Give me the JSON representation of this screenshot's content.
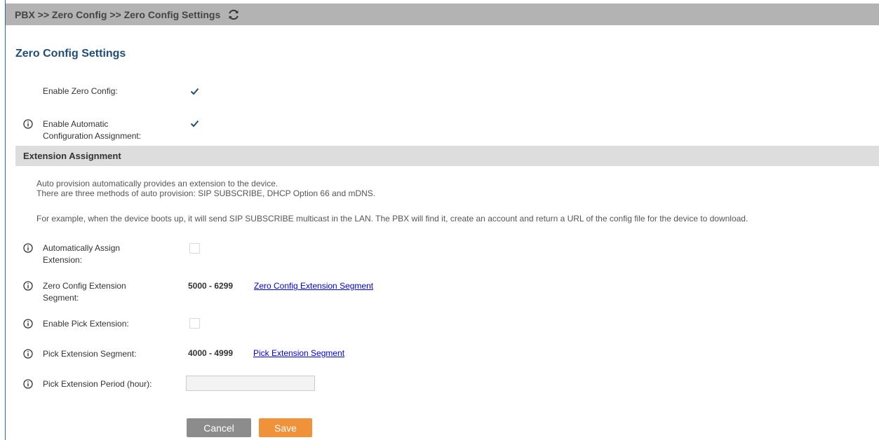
{
  "breadcrumb": {
    "text": "PBX >> Zero Config >> Zero Config Settings",
    "refresh_icon": "refresh-icon"
  },
  "page": {
    "title": "Zero Config Settings"
  },
  "fields": {
    "enable_zero_config": {
      "label": "Enable Zero Config:",
      "checked": true
    },
    "enable_auto_config": {
      "label_line1": "Enable Automatic",
      "label_line2": "Configuration Assignment:",
      "checked": true
    },
    "auto_assign_ext": {
      "label_line1": "Automatically Assign",
      "label_line2": "Extension:",
      "checked": false
    },
    "zero_config_segment": {
      "label_line1": "Zero Config Extension",
      "label_line2": "Segment:",
      "value": "5000 - 6299",
      "link": "Zero Config Extension Segment"
    },
    "enable_pick_ext": {
      "label": "Enable Pick Extension:",
      "checked": false
    },
    "pick_ext_segment": {
      "label": "Pick Extension Segment:",
      "value": "4000 - 4999",
      "link": "Pick Extension Segment"
    },
    "pick_ext_period": {
      "label": "Pick Extension Period (hour):",
      "value": ""
    }
  },
  "section": {
    "title": "Extension Assignment",
    "desc_line1": "Auto provision automatically provides an extension to the device.",
    "desc_line2": "There are three methods of auto provision: SIP SUBSCRIBE, DHCP Option 66 and mDNS.",
    "desc_line3": "For example, when the device boots up, it will send SIP SUBSCRIBE multicast in the LAN. The PBX will find it, create an account and return a URL of the config file for the device to download."
  },
  "buttons": {
    "cancel": "Cancel",
    "save": "Save"
  },
  "colors": {
    "title": "#1f4e79",
    "link": "#0000ee",
    "save": "#f0923a",
    "cancel": "#8c8c8c",
    "check": "#1f4e79"
  }
}
